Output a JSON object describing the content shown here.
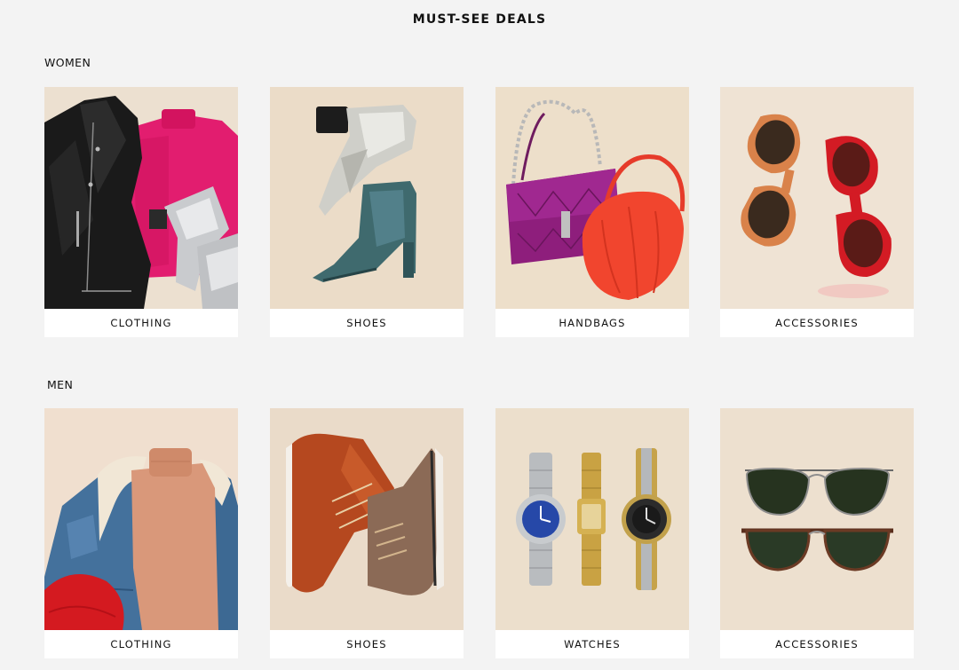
{
  "header": {
    "title": "MUST-SEE DEALS"
  },
  "sections": [
    {
      "label": "WOMEN",
      "items": [
        {
          "label": "CLOTHING",
          "icon": "women-clothing-photo"
        },
        {
          "label": "SHOES",
          "icon": "women-shoes-photo"
        },
        {
          "label": "HANDBAGS",
          "icon": "handbags-photo"
        },
        {
          "label": "ACCESSORIES",
          "icon": "women-sunglasses-photo"
        }
      ]
    },
    {
      "label": "MEN",
      "items": [
        {
          "label": "CLOTHING",
          "icon": "men-clothing-photo"
        },
        {
          "label": "SHOES",
          "icon": "men-boots-photo"
        },
        {
          "label": "WATCHES",
          "icon": "watches-photo"
        },
        {
          "label": "ACCESSORIES",
          "icon": "aviator-sunglasses-photo"
        }
      ]
    }
  ],
  "colors": {
    "page_background": "#f3f3f3",
    "card_background": "#ffffff",
    "photo_backdrop": "#eadcc8",
    "text": "#111111"
  }
}
